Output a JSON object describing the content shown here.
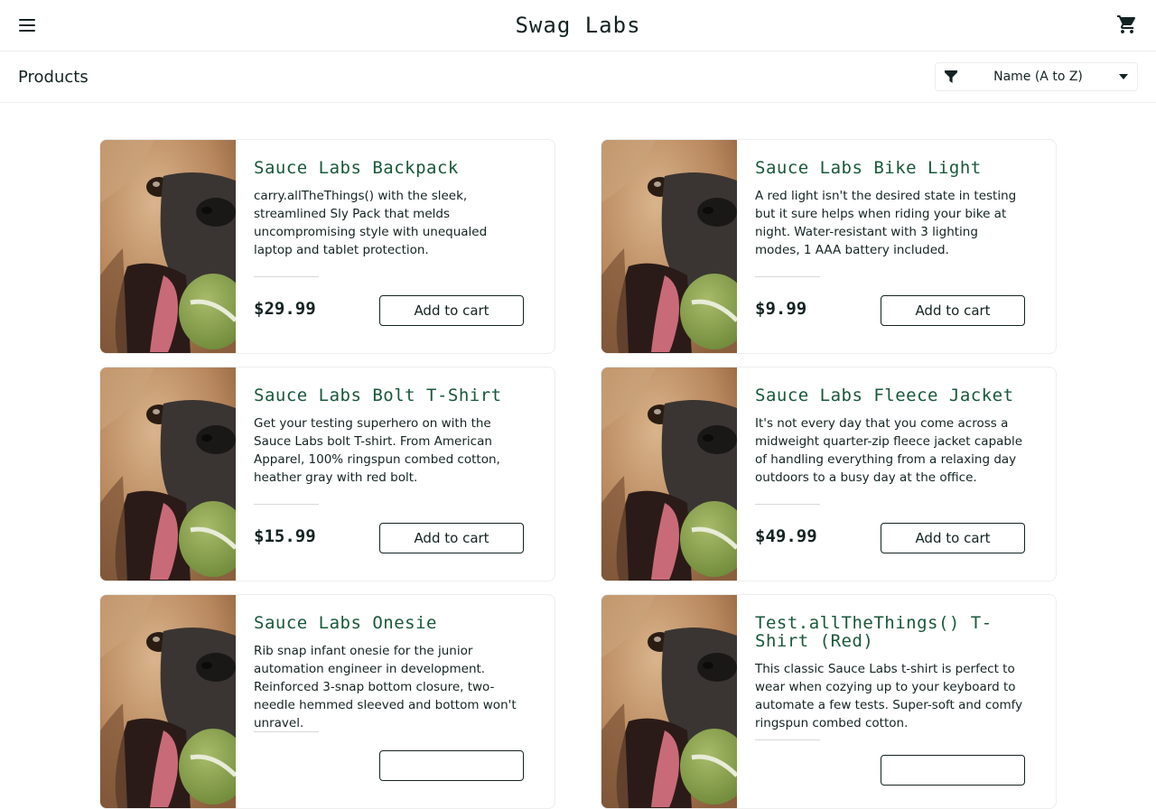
{
  "header": {
    "title": "Swag Labs",
    "menu_icon": "hamburger-icon",
    "cart_icon": "shopping-cart-icon"
  },
  "subheader": {
    "title": "Products",
    "sort": {
      "selected": "Name (A to Z)",
      "icon": "filter-icon"
    }
  },
  "colors": {
    "item_name": "#18583a",
    "text": "#132322",
    "border": "#ededed"
  },
  "products": [
    {
      "name": "Sauce Labs Backpack",
      "description": "carry.allTheThings() with the sleek, streamlined Sly Pack that melds uncompromising style with unequaled laptop and tablet protection.",
      "price": "$29.99",
      "button": "Add to cart"
    },
    {
      "name": "Sauce Labs Bike Light",
      "description": "A red light isn't the desired state in testing but it sure helps when riding your bike at night. Water-resistant with 3 lighting modes, 1 AAA battery included.",
      "price": "$9.99",
      "button": "Add to cart"
    },
    {
      "name": "Sauce Labs Bolt T-Shirt",
      "description": "Get your testing superhero on with the Sauce Labs bolt T-shirt. From American Apparel, 100% ringspun combed cotton, heather gray with red bolt.",
      "price": "$15.99",
      "button": "Add to cart"
    },
    {
      "name": "Sauce Labs Fleece Jacket",
      "description": "It's not every day that you come across a midweight quarter-zip fleece jacket capable of handling everything from a relaxing day outdoors to a busy day at the office.",
      "price": "$49.99",
      "button": "Add to cart"
    },
    {
      "name": "Sauce Labs Onesie",
      "description": "Rib snap infant onesie for the junior automation engineer in development. Reinforced 3-snap bottom closure, two-needle hemmed sleeved and bottom won't unravel.",
      "price": "",
      "button": ""
    },
    {
      "name": "Test.allTheThings() T-Shirt (Red)",
      "description": "This classic Sauce Labs t-shirt is perfect to wear when cozying up to your keyboard to automate a few tests. Super-soft and comfy ringspun combed cotton.",
      "price": "",
      "button": ""
    }
  ]
}
